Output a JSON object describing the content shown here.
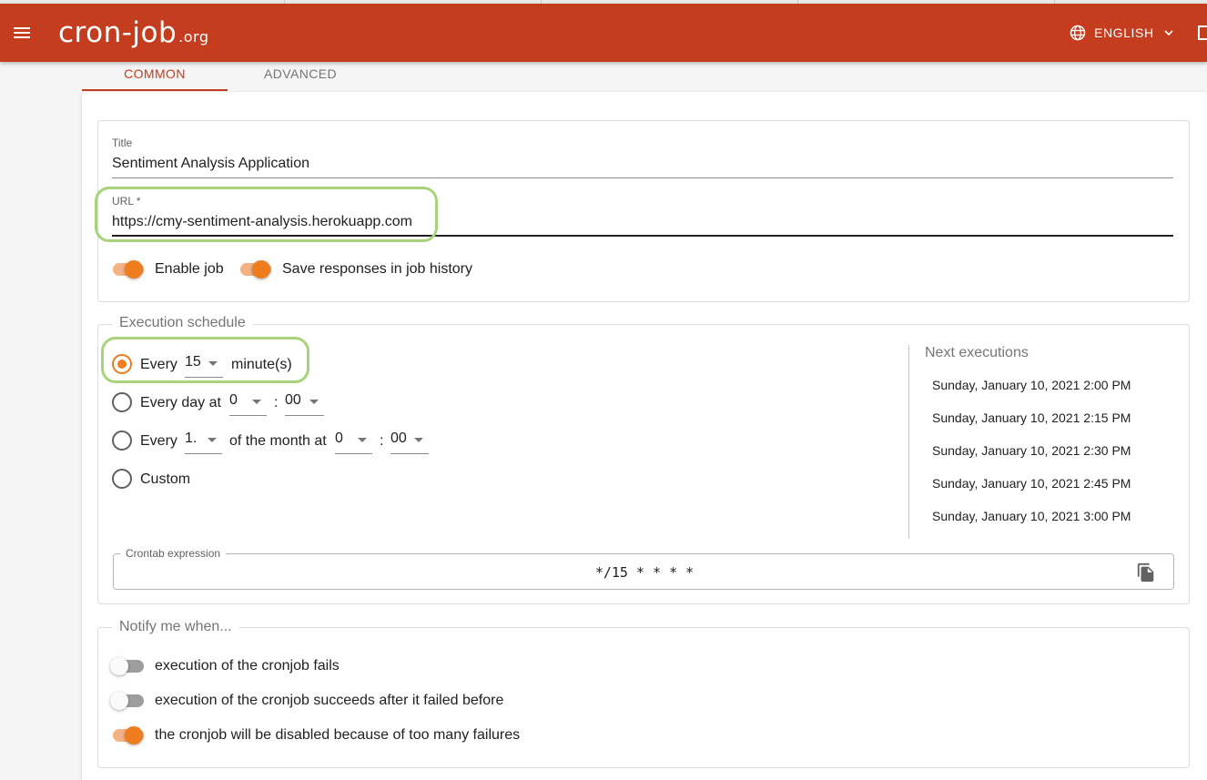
{
  "app": {
    "logo_main": "cron-job",
    "logo_suffix": ".org",
    "language": "ENGLISH",
    "icons": {
      "menu": "menu-icon",
      "language": "globe-icon",
      "language_dropdown": "chevron-down-icon"
    }
  },
  "tabs": [
    {
      "label": "COMMON",
      "active": true
    },
    {
      "label": "ADVANCED",
      "active": false
    }
  ],
  "job": {
    "title_label": "Title",
    "title_value": "Sentiment Analysis Application",
    "url_label": "URL *",
    "url_value": "https://cmy-sentiment-analysis.herokuapp.com",
    "enable_job": {
      "label": "Enable job",
      "on": true
    },
    "save_responses": {
      "label": "Save responses in job history",
      "on": true
    }
  },
  "schedule": {
    "legend": "Execution schedule",
    "every_minutes": {
      "prefix": "Every",
      "value": "15",
      "suffix": "minute(s)",
      "selected": true
    },
    "every_day": {
      "prefix": "Every day at",
      "hour": "0",
      "separator": ":",
      "minute": "00",
      "selected": false
    },
    "every_month": {
      "prefix": "Every",
      "day": "1.",
      "middle": "of the month at",
      "hour": "0",
      "separator": ":",
      "minute": "00",
      "selected": false
    },
    "custom": {
      "label": "Custom",
      "selected": false
    },
    "next_executions_title": "Next executions",
    "next_executions": [
      "Sunday, January 10, 2021 2:00 PM",
      "Sunday, January 10, 2021 2:15 PM",
      "Sunday, January 10, 2021 2:30 PM",
      "Sunday, January 10, 2021 2:45 PM",
      "Sunday, January 10, 2021 3:00 PM"
    ],
    "crontab_label": "Crontab expression",
    "crontab_value": "*/15 * * * *",
    "copy_icon": "copy-icon"
  },
  "notify": {
    "legend": "Notify me when...",
    "items": [
      {
        "label": "execution of the cronjob fails",
        "on": false
      },
      {
        "label": "execution of the cronjob succeeds after it failed before",
        "on": false
      },
      {
        "label": "the cronjob will be disabled because of too many failures",
        "on": true
      }
    ]
  },
  "colors": {
    "appbar": "#c33d1e",
    "accent": "#ee7d1f",
    "highlight": "#a9d37a"
  }
}
